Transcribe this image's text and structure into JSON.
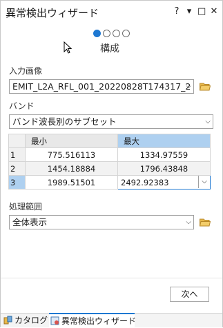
{
  "window": {
    "title": "異常検出ウィザード",
    "controls": [
      "?",
      "▾",
      "□",
      "✕"
    ]
  },
  "steps": {
    "count": 4,
    "active_index": 0,
    "label": "構成"
  },
  "input_raster": {
    "label": "入力画像",
    "value": "EMIT_L2A_RFL_001_20220828T174317_2"
  },
  "bands": {
    "label": "バンド",
    "value": "バンド波長別のサブセット"
  },
  "band_table": {
    "columns": [
      "最小",
      "最大"
    ],
    "rows": [
      {
        "index": "1",
        "min": "775.516113",
        "max": "1334.97559"
      },
      {
        "index": "2",
        "min": "1454.18884",
        "max": "1796.43848"
      },
      {
        "index": "3",
        "min": "1989.51501",
        "max": "2492.92383"
      }
    ]
  },
  "processing_extent": {
    "label": "処理範囲",
    "value": "全体表示"
  },
  "next_button": "次へ",
  "bottom_tabs": [
    {
      "label": "カタログ",
      "icon": "catalog-icon"
    },
    {
      "label": "異常検出ウィザード",
      "icon": "wizard-icon"
    }
  ],
  "colors": {
    "accent": "#1e78d2",
    "selection": "#aed0f0",
    "folder": "#e8b84a"
  }
}
